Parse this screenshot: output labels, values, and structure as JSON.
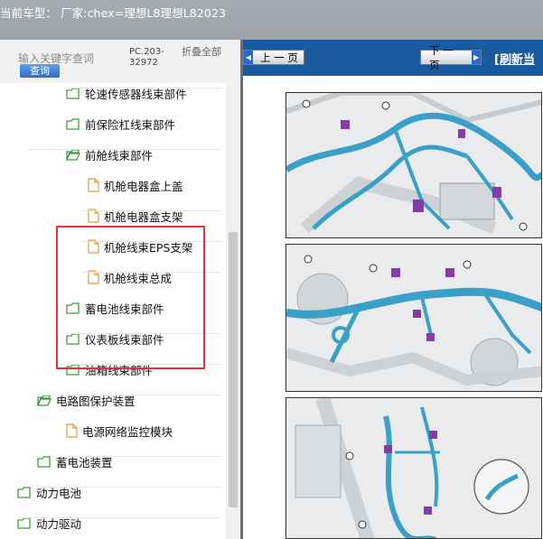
{
  "header": {
    "title": "当前车型：  厂家:chex=理想L8理想L82023"
  },
  "search": {
    "placeholder": "输入关键字查词",
    "query_button": "查询",
    "code": "PC.203-32972",
    "fold_all": "折叠全部"
  },
  "tree": {
    "items": [
      {
        "label": "轮速传感器线束部件",
        "icon": "folder-icon"
      },
      {
        "label": "前保险杠线束部件",
        "icon": "folder-icon"
      },
      {
        "label": "前舱线束部件",
        "icon": "folder-open-icon"
      },
      {
        "label": "机舱电器盒上盖",
        "icon": "document-icon"
      },
      {
        "label": "机舱电器盒支架",
        "icon": "document-icon"
      },
      {
        "label": "机舱线束EPS支架",
        "icon": "document-icon"
      },
      {
        "label": "机舱线束总成",
        "icon": "document-icon"
      },
      {
        "label": "蓄电池线束部件",
        "icon": "folder-icon"
      },
      {
        "label": "仪表板线束部件",
        "icon": "folder-icon"
      },
      {
        "label": "油箱线束部件",
        "icon": "folder-icon"
      },
      {
        "label": "电路图保护装置",
        "icon": "folder-open-icon"
      },
      {
        "label": "电源网络监控模块",
        "icon": "document-icon"
      },
      {
        "label": "蓄电池装置",
        "icon": "folder-icon"
      },
      {
        "label": "动力电池",
        "icon": "folder-icon"
      },
      {
        "label": "动力驱动",
        "icon": "folder-icon"
      }
    ]
  },
  "viewer": {
    "prev_label": "上 一 页",
    "next_label": "下 一 页",
    "refresh_label": "[刷新当"
  },
  "colors": {
    "nav": "#1a5a9e",
    "highlight": "#d9363e",
    "harness": "#3aa0c8",
    "connector": "#8a3aa8",
    "folder": "#3f9a3a"
  }
}
